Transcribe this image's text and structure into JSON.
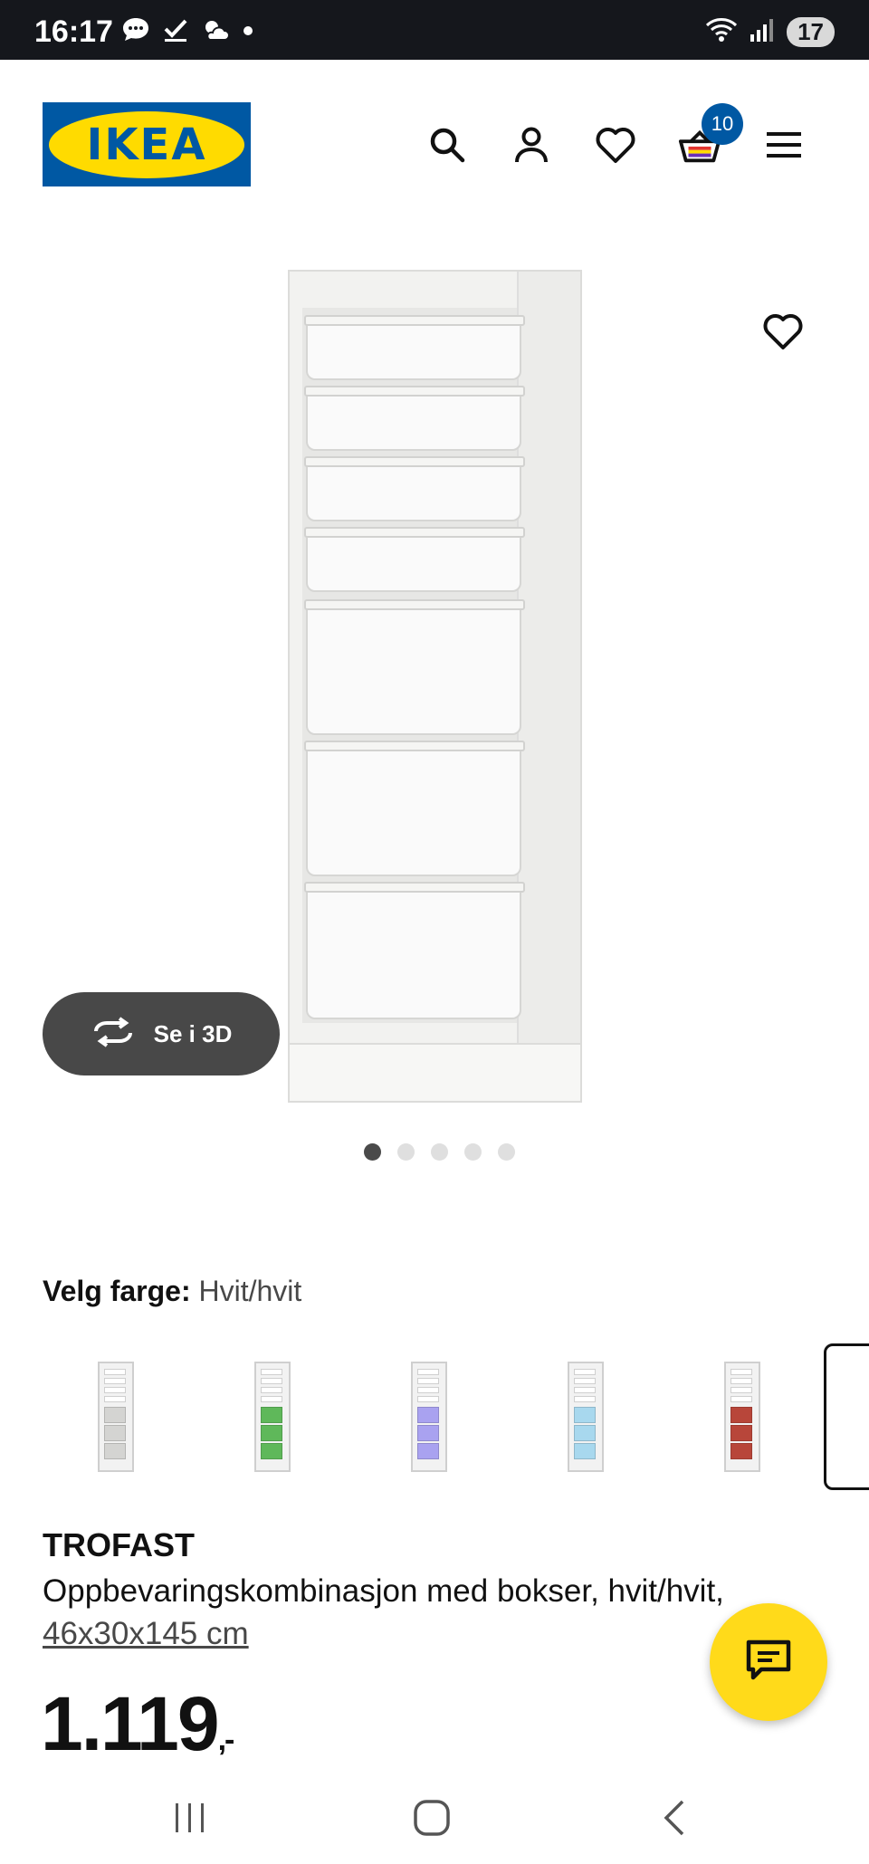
{
  "status_bar": {
    "time": "16:17",
    "battery": "17"
  },
  "header": {
    "logo_text": "IKEA",
    "cart_count": "10",
    "icons": [
      "search-icon",
      "account-icon",
      "heart-icon",
      "cart-icon",
      "menu-icon"
    ]
  },
  "gallery": {
    "see_3d_label": "Se i 3D",
    "image_count": 5,
    "active_index": 0
  },
  "color_select": {
    "label": "Velg farge:",
    "value": "Hvit/hvit",
    "options": [
      {
        "name": "grey",
        "color": "#d4d4d2"
      },
      {
        "name": "green",
        "color": "#5fb85a"
      },
      {
        "name": "lilac",
        "color": "#a9a2f0"
      },
      {
        "name": "light-blue",
        "color": "#a8d8ee"
      },
      {
        "name": "red",
        "color": "#b8463a"
      }
    ]
  },
  "product": {
    "name": "TROFAST",
    "description": "Oppbevaringskombinasjon med bokser, hvit/hvit,",
    "dimensions": "46x30x145 cm",
    "price": "1.119",
    "price_suffix": ",-"
  },
  "colors": {
    "ikea_blue": "#0058a3",
    "ikea_yellow": "#ffdb00",
    "chat_yellow": "#ffda1a"
  }
}
